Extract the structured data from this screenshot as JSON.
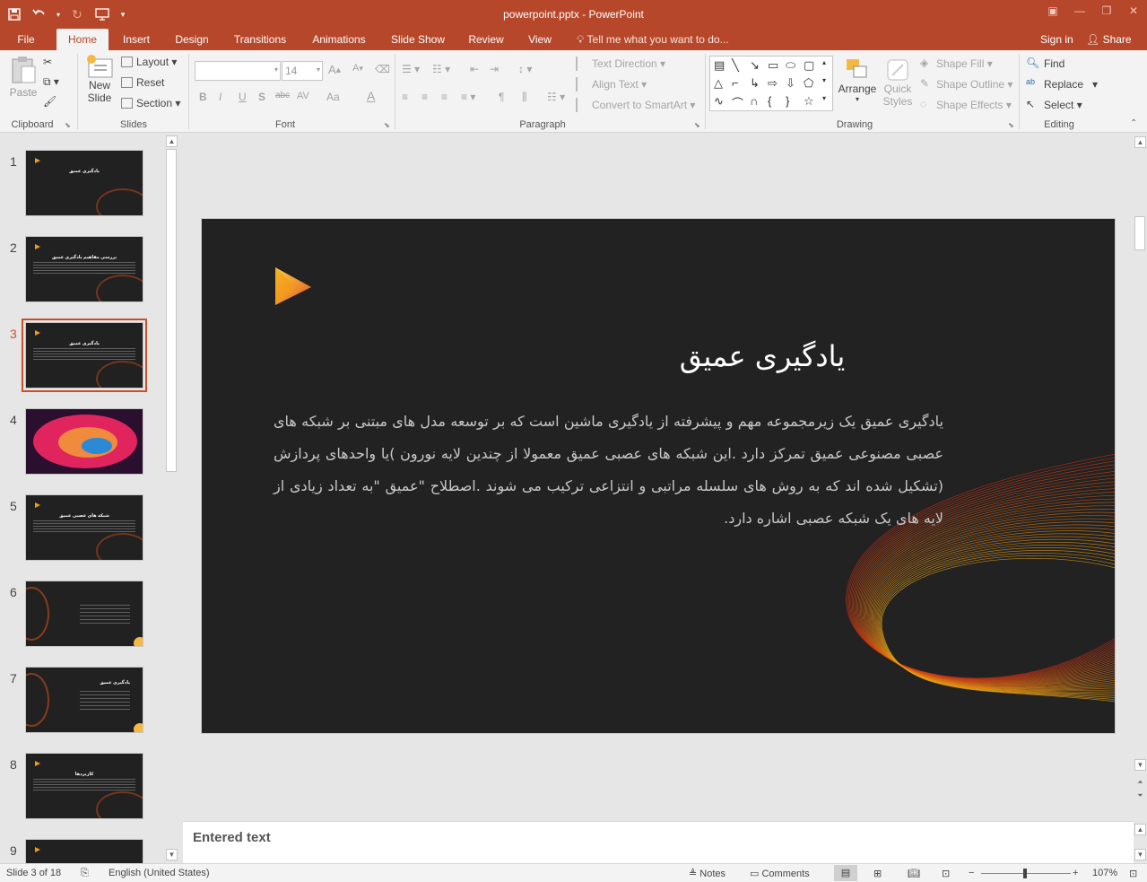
{
  "app": {
    "title": "powerpoint.pptx - PowerPoint"
  },
  "qat": {
    "save_icon": "save-icon",
    "undo_icon": "undo-icon",
    "redo_icon": "redo-icon",
    "present_icon": "present-icon",
    "customize_icon": "chevron-down-icon"
  },
  "tabs": [
    "File",
    "Home",
    "Insert",
    "Design",
    "Transitions",
    "Animations",
    "Slide Show",
    "Review",
    "View"
  ],
  "tell_me": "Tell me what you want to do...",
  "account": {
    "sign_in": "Sign in",
    "share": "Share"
  },
  "ribbon": {
    "clipboard": {
      "label": "Clipboard",
      "paste": "Paste"
    },
    "slides": {
      "label": "Slides",
      "new_slide_line1": "New",
      "new_slide_line2": "Slide",
      "layout": "Layout",
      "reset": "Reset",
      "section": "Section"
    },
    "font": {
      "label": "Font",
      "font_name": "",
      "font_size": "14",
      "bold": "B",
      "italic": "I",
      "underline": "U",
      "shadow": "S",
      "strike": "abc",
      "spacing": "AV",
      "case": "Aa",
      "color": "A"
    },
    "paragraph": {
      "label": "Paragraph",
      "text_direction": "Text Direction",
      "align_text": "Align Text",
      "convert_smartart": "Convert to SmartArt"
    },
    "drawing": {
      "label": "Drawing",
      "arrange": "Arrange",
      "quick_styles_line1": "Quick",
      "quick_styles_line2": "Styles",
      "shape_fill": "Shape Fill",
      "shape_outline": "Shape Outline",
      "shape_effects": "Shape Effects"
    },
    "editing": {
      "label": "Editing",
      "find": "Find",
      "replace": "Replace",
      "select": "Select"
    }
  },
  "thumbnails": [
    {
      "num": "1",
      "title": "یادگیری عمیق",
      "selected": false
    },
    {
      "num": "2",
      "title": "بررسی مفاهیم یادگیری عمیق",
      "selected": false
    },
    {
      "num": "3",
      "title": "یادگیری عمیق",
      "selected": true
    },
    {
      "num": "4",
      "title": "",
      "selected": false
    },
    {
      "num": "5",
      "title": "شبکه های عصبی عمیق",
      "selected": false
    },
    {
      "num": "6",
      "title": "",
      "selected": false
    },
    {
      "num": "7",
      "title": "یادگیری عمیق",
      "selected": false
    },
    {
      "num": "8",
      "title": "کاربردها",
      "selected": false
    },
    {
      "num": "9",
      "title": "",
      "selected": false
    }
  ],
  "slide": {
    "title": "یادگیری عمیق",
    "body": "یادگیری عمیق یک زیرمجموعه مهم و پیشرفته از یادگیری ماشین است که بر توسعه مدل های مبتنی بر شبکه های عصبی مصنوعی عمیق تمرکز دارد .این شبکه های عصبی عمیق معمولا از چندین لایه نورون )یا واحدهای پردازش (تشکیل شده اند که به روش های سلسله مراتبی و انتزاعی ترکیب می شوند .اصطلاح \"عمیق \"به تعداد زیادی از لایه های یک شبکه عصبی اشاره دارد.",
    "accent_color": "#f39c12",
    "bg_color": "#222222"
  },
  "notes": {
    "text": "Entered text"
  },
  "status": {
    "slide_of": "Slide 3 of 18",
    "language": "English (United States)",
    "notes": "Notes",
    "comments": "Comments",
    "zoom": "107%",
    "zoom_level_percent": 107
  }
}
